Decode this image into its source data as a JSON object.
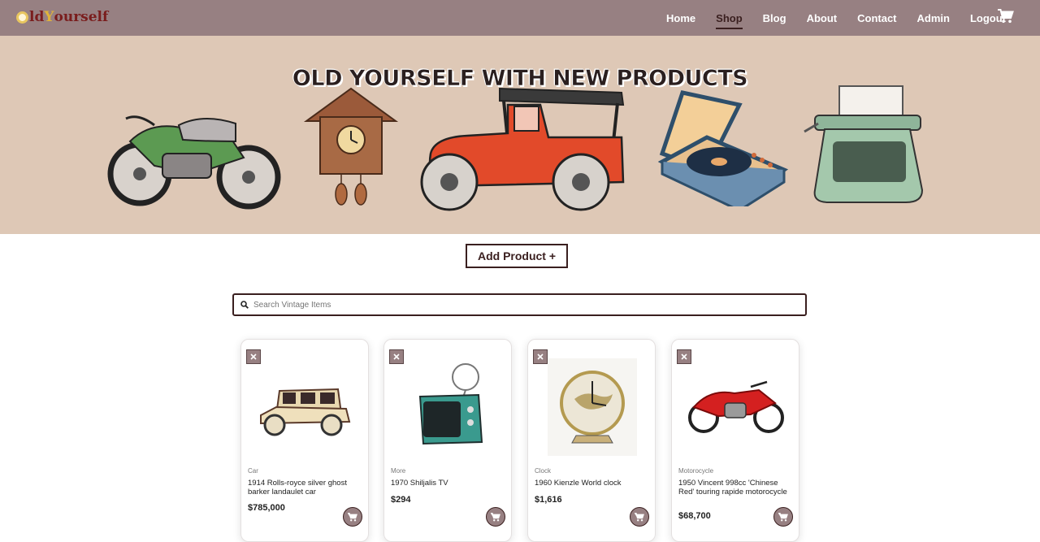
{
  "brand": {
    "logo_text_a": "ld",
    "logo_text_b": "Y",
    "logo_text_c": "ourself"
  },
  "nav": {
    "items": [
      "Home",
      "Shop",
      "Blog",
      "About",
      "Contact",
      "Admin",
      "Logout"
    ],
    "active": "Shop"
  },
  "hero": {
    "title": "OLD YOURSELF WITH NEW PRODUCTS"
  },
  "add_product_label": "Add Product +",
  "search": {
    "placeholder": "Search Vintage Items"
  },
  "products": [
    {
      "category": "Car",
      "name": "1914 Rolls-royce silver ghost barker landaulet car",
      "price": "$785,000"
    },
    {
      "category": "More",
      "name": "1970 Shiljalis TV",
      "price": "$294"
    },
    {
      "category": "Clock",
      "name": "1960 Kienzle World clock",
      "price": "$1,616"
    },
    {
      "category": "Motorocycle",
      "name": "1950 Vincent 998cc 'Chinese Red' touring rapide motorocycle",
      "price": "$68,700"
    }
  ],
  "colors": {
    "nav_bg": "#978082",
    "hero_bg": "#dec8b6",
    "accent_dark": "#3a1f1f"
  }
}
